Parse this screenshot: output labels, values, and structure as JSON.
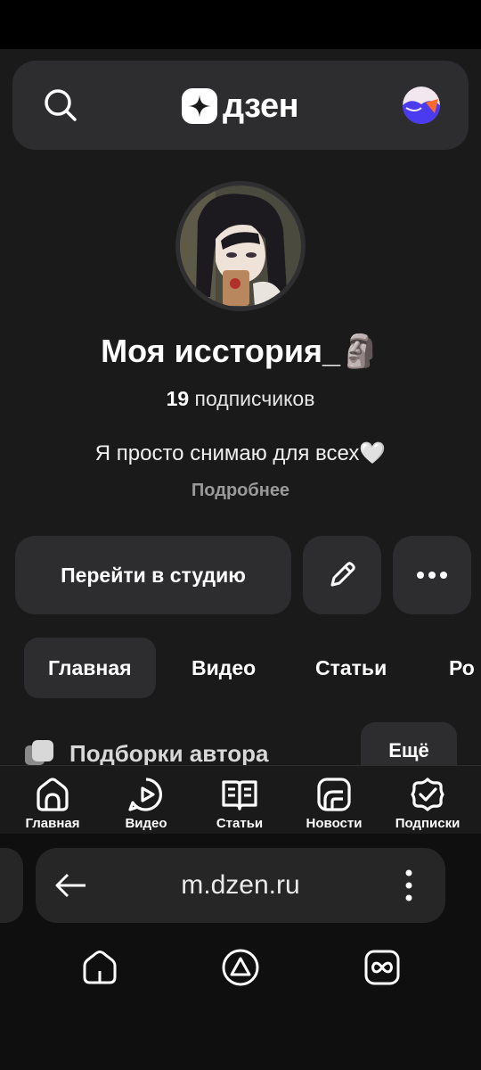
{
  "header": {
    "logo_text": "дзен"
  },
  "profile": {
    "title": "Моя исстория_🗿",
    "subscribers_count": "19",
    "subscribers_label": "подписчиков",
    "description": "Я просто снимаю для всех🤍",
    "more_link": "Подробнее"
  },
  "actions": {
    "studio_label": "Перейти в студию"
  },
  "tabs": [
    {
      "label": "Главная",
      "active": true
    },
    {
      "label": "Видео"
    },
    {
      "label": "Статьи"
    },
    {
      "label": "Ро"
    }
  ],
  "section": {
    "title": "Подборки автора",
    "more_label": "Ещё"
  },
  "bottom_nav": [
    {
      "label": "Главная",
      "icon": "home-icon"
    },
    {
      "label": "Видео",
      "icon": "video-icon"
    },
    {
      "label": "Статьи",
      "icon": "articles-icon"
    },
    {
      "label": "Новости",
      "icon": "news-icon"
    },
    {
      "label": "Подписки",
      "icon": "subscriptions-icon"
    }
  ],
  "browser": {
    "url": "m.dzen.ru"
  },
  "colors": {
    "background": "#1a1a1a",
    "surface": "#2d2d2f",
    "muted_text": "#9a9a9a"
  }
}
